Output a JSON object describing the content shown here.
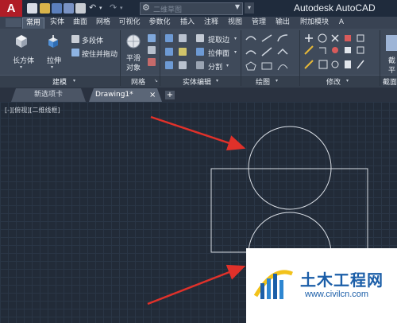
{
  "app": {
    "title": "Autodesk AutoCAD",
    "logo_letter": "A",
    "workspace": "二维草图"
  },
  "ribbon_tabs": [
    "常用",
    "实体",
    "曲面",
    "网格",
    "可视化",
    "参数化",
    "插入",
    "注释",
    "视图",
    "管理",
    "输出",
    "附加模块",
    "A"
  ],
  "active_tab": "常用",
  "panels": {
    "modeling": {
      "title": "建模",
      "box_label": "长方体",
      "extrude_label": "拉伸",
      "polysolid_label": "多段体",
      "presspull_label": "按住并拖动"
    },
    "mesh": {
      "title": "网格",
      "smooth_label_1": "平滑",
      "smooth_label_2": "对象"
    },
    "solid_editing": {
      "title": "实体编辑",
      "extract_edges_label": "提取边",
      "extrude_face_label": "拉伸面",
      "separate_label": "分割"
    },
    "draw": {
      "title": "绘图"
    },
    "modify": {
      "title": "修改"
    },
    "section": {
      "title": "截面",
      "plane_label_1": "截",
      "plane_label_2": "平"
    }
  },
  "file_tabs": {
    "start": "新选项卡",
    "drawing": "Drawing1*",
    "close_glyph": "×",
    "new_glyph": "+"
  },
  "canvas": {
    "viewport_label": "[-][俯视][二维线框]",
    "background": "#222b38",
    "geometry_color": "#d8dde4",
    "arrow_color": "#e0312a"
  },
  "watermark": {
    "name": "土木工程网",
    "url": "www.civilcn.com"
  }
}
